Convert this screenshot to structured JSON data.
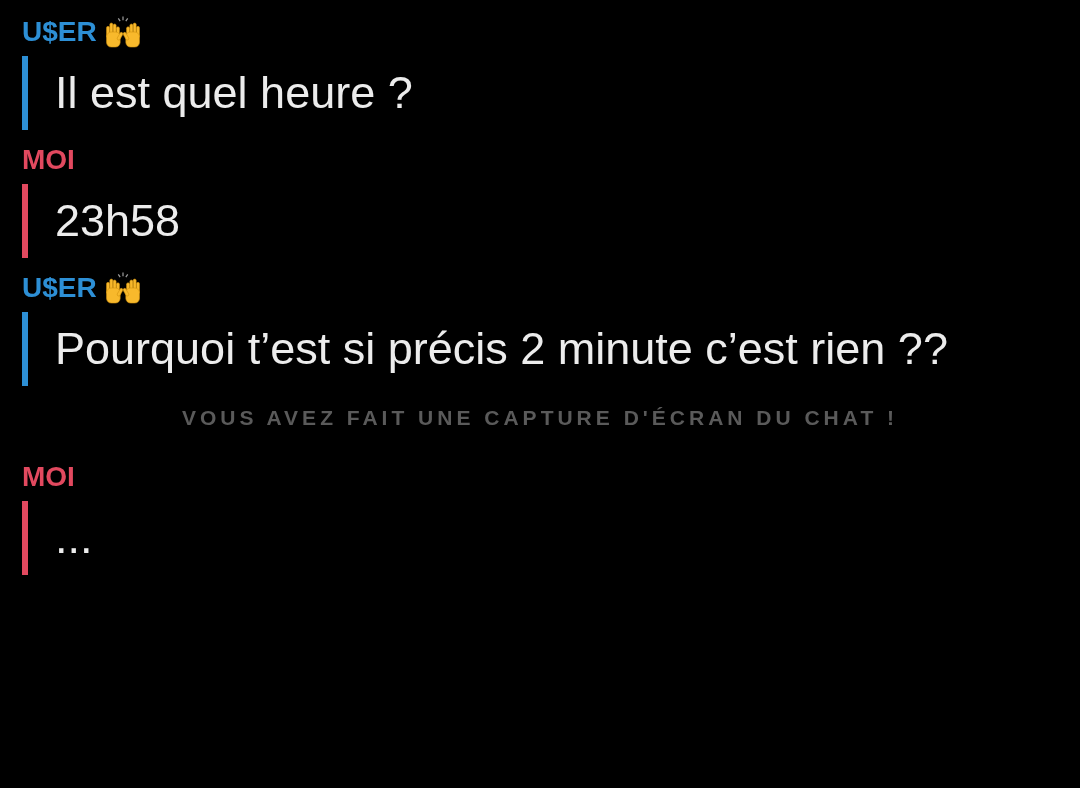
{
  "messages": [
    {
      "kind": "message",
      "sender": {
        "name": "U$ER",
        "emoji_badge": true
      },
      "color": "#2d8fd5",
      "text": "Il est quel heure ?"
    },
    {
      "kind": "message",
      "sender": {
        "name": "MOI",
        "emoji_badge": false
      },
      "color": "#e2495f",
      "text": "23h58"
    },
    {
      "kind": "message",
      "sender": {
        "name": "U$ER",
        "emoji_badge": true
      },
      "color": "#2d8fd5",
      "text": "Pourquoi t’est si précis 2 minute c’est rien ??"
    },
    {
      "kind": "notice",
      "text": "VOUS AVEZ FAIT UNE CAPTURE D'ÉCRAN DU CHAT !"
    },
    {
      "kind": "message",
      "sender": {
        "name": "MOI",
        "emoji_badge": false
      },
      "color": "#e2495f",
      "text": "..."
    }
  ]
}
